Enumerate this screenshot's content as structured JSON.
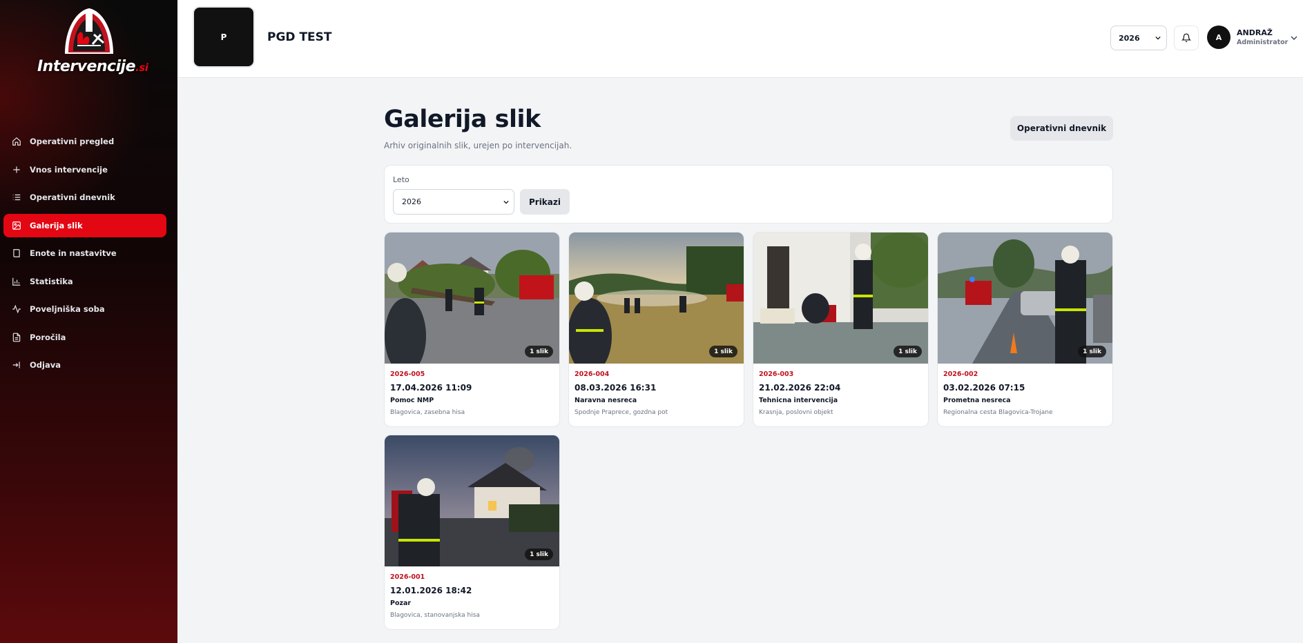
{
  "brand": {
    "name": "Intervencije",
    "suffix": ".si"
  },
  "sidebar": {
    "items": [
      {
        "label": "Operativni pregled",
        "icon": "home-icon",
        "active": false
      },
      {
        "label": "Vnos intervencije",
        "icon": "plus-icon",
        "active": false
      },
      {
        "label": "Operativni dnevnik",
        "icon": "list-icon",
        "active": false
      },
      {
        "label": "Galerija slik",
        "icon": "image-icon",
        "active": true
      },
      {
        "label": "Enote in nastavitve",
        "icon": "book-icon",
        "active": false
      },
      {
        "label": "Statistika",
        "icon": "bar-chart-icon",
        "active": false
      },
      {
        "label": "Poveljniška soba",
        "icon": "activity-icon",
        "active": false
      },
      {
        "label": "Poročila",
        "icon": "file-icon",
        "active": false
      },
      {
        "label": "Odjava",
        "icon": "logout-icon",
        "active": false
      }
    ]
  },
  "header": {
    "org_initial": "P",
    "org_name": "PGD TEST",
    "year": "2026",
    "user": {
      "initial": "A",
      "name": "ANDRAŽ",
      "role": "Administrator"
    }
  },
  "main": {
    "title": "Galerija slik",
    "subtitle": "Arhiv originalnih slik, urejen po intervencijah.",
    "top_button": "Operativni dnevnik",
    "filter": {
      "label": "Leto",
      "value": "2026",
      "button": "Prikazi"
    },
    "cards": [
      {
        "id": "2026-005",
        "date": "17.04.2026 11:09",
        "type": "Pomoc NMP",
        "location": "Blagovica, zasebna hisa",
        "count": "1 slik"
      },
      {
        "id": "2026-004",
        "date": "08.03.2026 16:31",
        "type": "Naravna nesreca",
        "location": "Spodnje Praprece, gozdna pot",
        "count": "1 slik"
      },
      {
        "id": "2026-003",
        "date": "21.02.2026 22:04",
        "type": "Tehnicna intervencija",
        "location": "Krasnja, poslovni objekt",
        "count": "1 slik"
      },
      {
        "id": "2026-002",
        "date": "03.02.2026 07:15",
        "type": "Prometna nesreca",
        "location": "Regionalna cesta Blagovica-Trojane",
        "count": "1 slik"
      },
      {
        "id": "2026-001",
        "date": "12.01.2026 18:42",
        "type": "Pozar",
        "location": "Blagovica, stanovanjska hisa",
        "count": "1 slik"
      }
    ]
  },
  "colors": {
    "accent": "#e30613",
    "id_red": "#c1121f",
    "sidebar_dark": "#0a0a0a"
  }
}
